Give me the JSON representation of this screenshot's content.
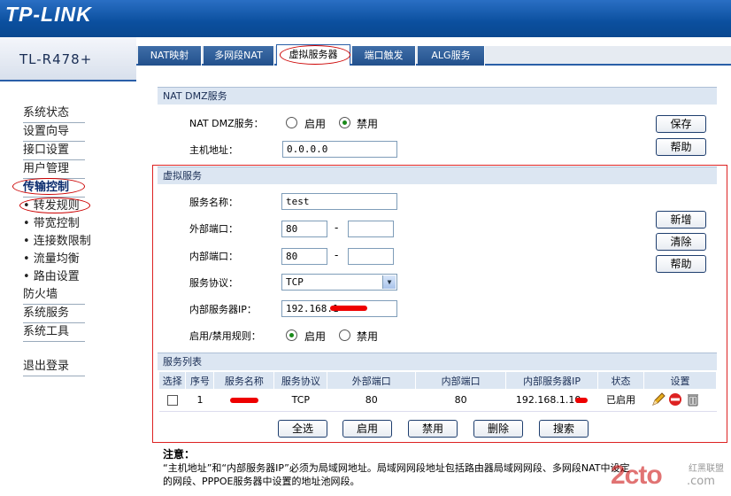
{
  "header": {
    "logo": "TP-LINK",
    "model": "TL-R478+"
  },
  "menu": {
    "items": [
      {
        "label": "系统状态"
      },
      {
        "label": "设置向导"
      },
      {
        "label": "接口设置"
      },
      {
        "label": "用户管理"
      },
      {
        "label": "传输控制"
      }
    ],
    "sub_items": [
      {
        "label": "• 转发规则"
      },
      {
        "label": "• 带宽控制"
      },
      {
        "label": "• 连接数限制"
      },
      {
        "label": "• 流量均衡"
      },
      {
        "label": "• 路由设置"
      }
    ],
    "items2": [
      {
        "label": "防火墙"
      },
      {
        "label": "系统服务"
      },
      {
        "label": "系统工具"
      }
    ],
    "logout": "退出登录"
  },
  "tabs": [
    {
      "label": "NAT映射"
    },
    {
      "label": "多网段NAT"
    },
    {
      "label": "虚拟服务器"
    },
    {
      "label": "端口触发"
    },
    {
      "label": "ALG服务"
    }
  ],
  "dmz": {
    "section_title": "NAT DMZ服务",
    "service_label": "NAT DMZ服务：",
    "enable_label": "启用",
    "disable_label": "禁用",
    "host_label": "主机地址：",
    "host_value": "0.0.0.0",
    "save_button": "保存",
    "help_button": "帮助"
  },
  "virtual": {
    "section_title": "虚拟服务",
    "name_label": "服务名称：",
    "name_value": "test",
    "ext_port_label": "外部端口：",
    "ext_port_from": "80",
    "int_port_label": "内部端口：",
    "int_port_from": "80",
    "dash": "-",
    "protocol_label": "服务协议：",
    "protocol_value": "TCP",
    "server_ip_label": "内部服务器IP：",
    "server_ip_value": "192.168.1",
    "rule_label": "启用/禁用规则：",
    "enable_label": "启用",
    "disable_label": "禁用",
    "add_button": "新增",
    "clear_button": "清除",
    "help_button": "帮助"
  },
  "list": {
    "section_title": "服务列表",
    "columns": [
      "选择",
      "序号",
      "服务名称",
      "服务协议",
      "外部端口",
      "内部端口",
      "内部服务器IP",
      "状态",
      "设置"
    ],
    "rows": [
      {
        "index": "1",
        "protocol": "TCP",
        "ext_port": "80",
        "int_port": "80",
        "server_ip": "192.168.1.10",
        "status": "已启用"
      }
    ],
    "buttons": [
      "全选",
      "启用",
      "禁用",
      "删除",
      "搜索"
    ]
  },
  "note": {
    "title": "注意：",
    "line1": "“主机地址”和“内部服务器IP”必须为局域网地址。局域网网段地址包括路由器局域网网段、多网段NAT中设定",
    "line2": "的网段、PPPOE服务器中设置的地址池网段。"
  },
  "watermark": {
    "brand": "2cto",
    "suffix": ".com",
    "tag": "红黑联盟"
  }
}
